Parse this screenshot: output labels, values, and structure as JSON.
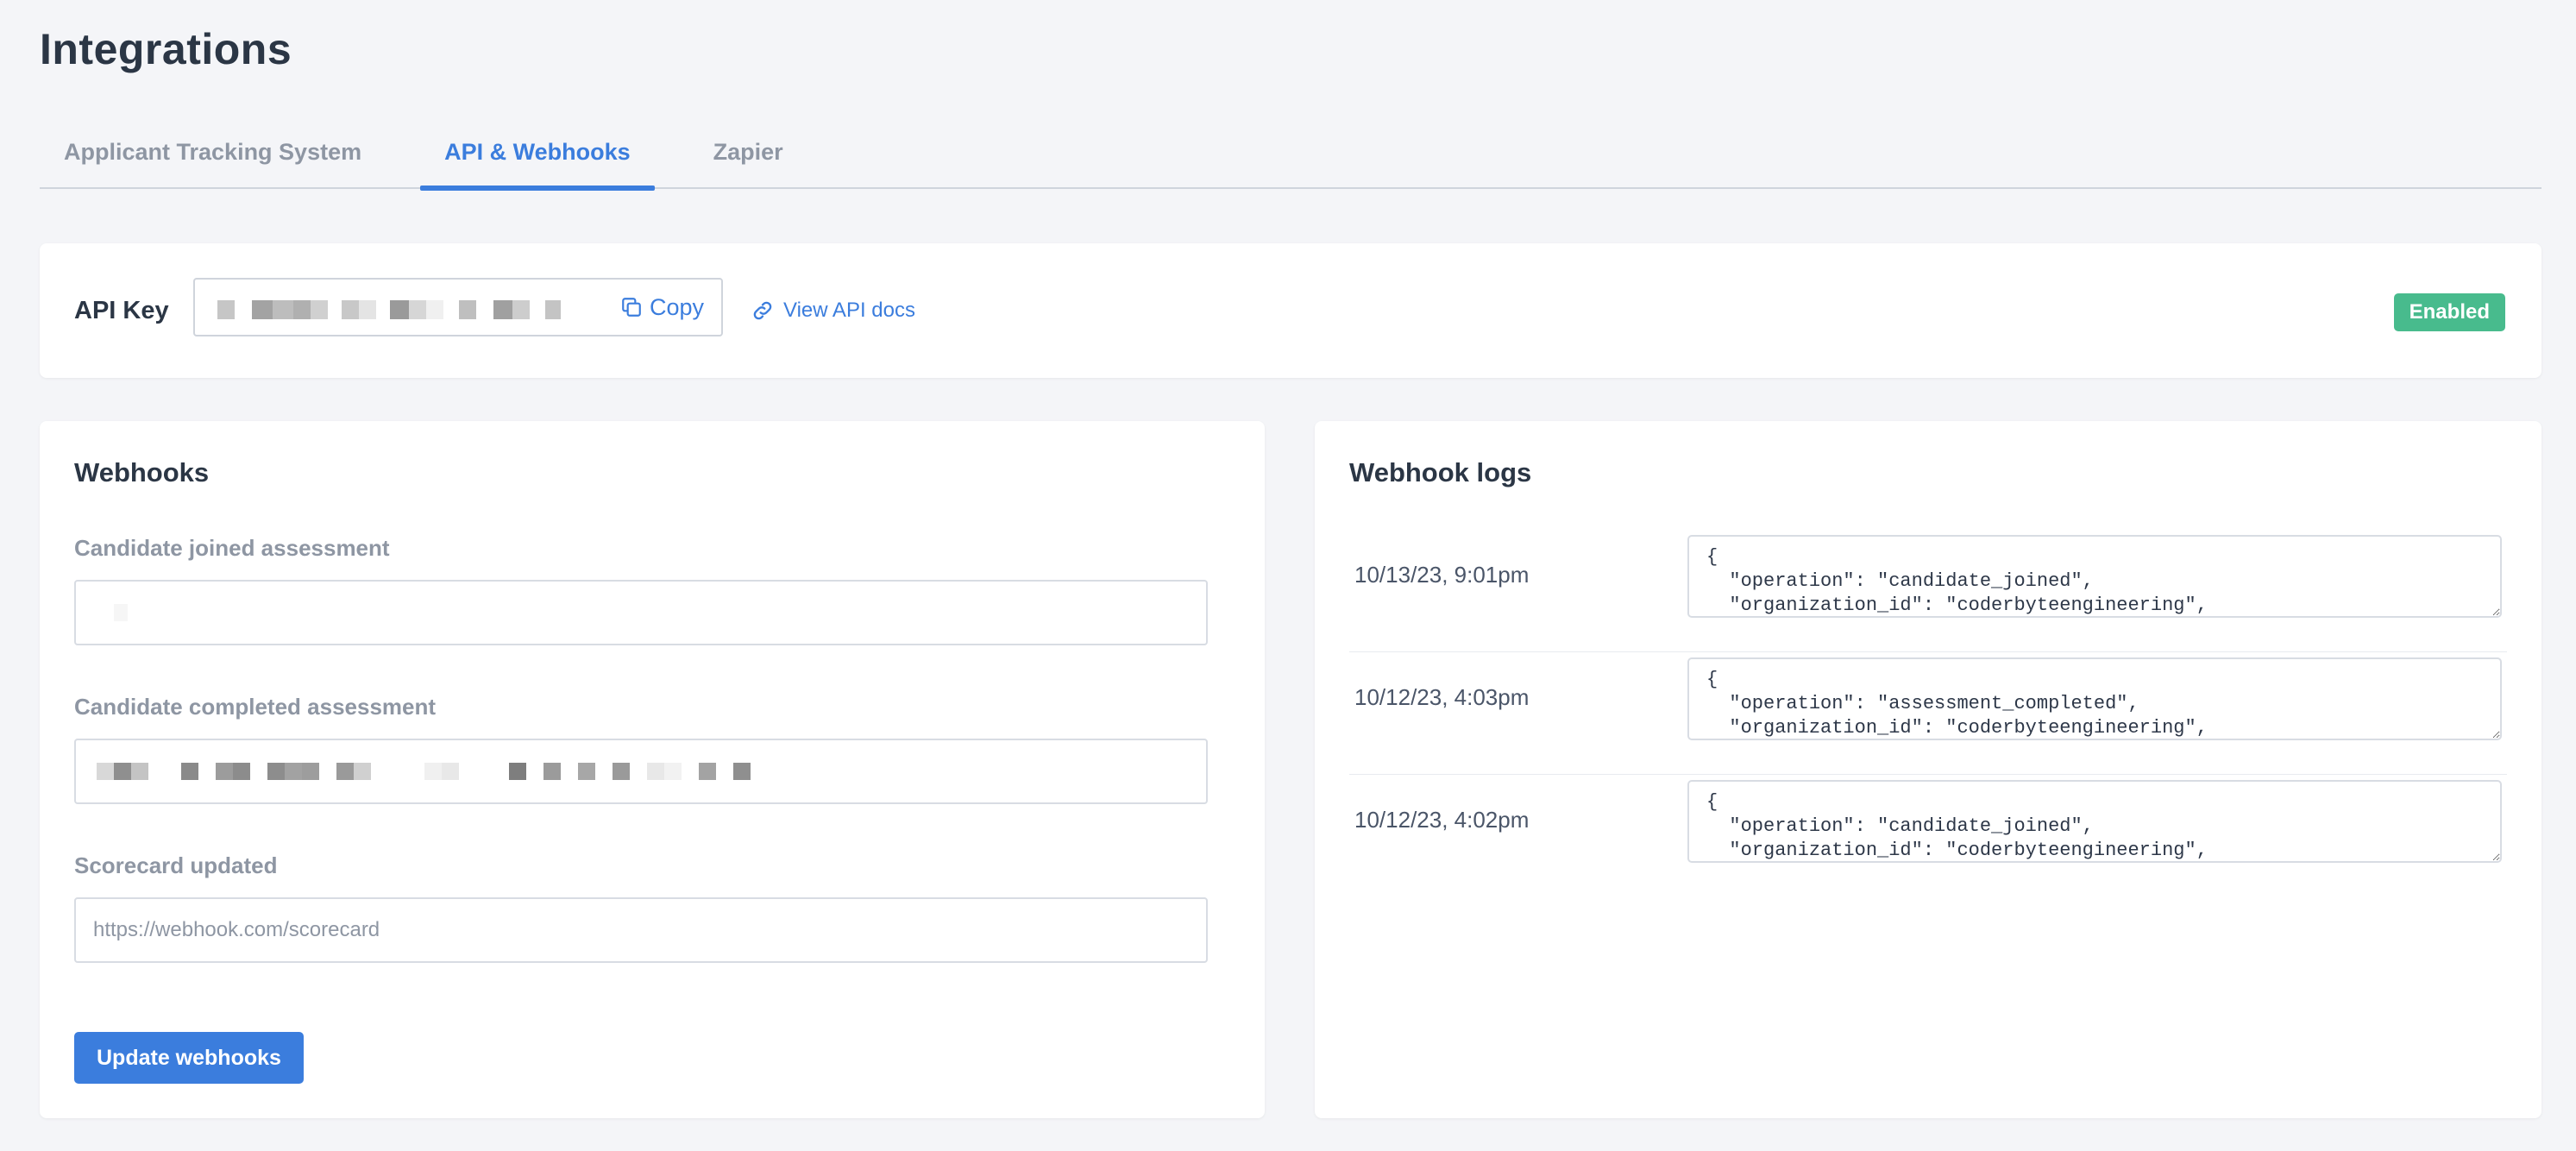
{
  "page": {
    "title": "Integrations"
  },
  "tabs": [
    {
      "label": "Applicant Tracking System",
      "active": false
    },
    {
      "label": "API & Webhooks",
      "active": true
    },
    {
      "label": "Zapier",
      "active": false
    }
  ],
  "api": {
    "label": "API Key",
    "copy_label": "Copy",
    "docs_label": "View API docs",
    "status": "Enabled"
  },
  "webhooks": {
    "title": "Webhooks",
    "fields": [
      {
        "label": "Candidate joined assessment",
        "value": "",
        "placeholder": ""
      },
      {
        "label": "Candidate completed assessment",
        "value": "",
        "placeholder": ""
      },
      {
        "label": "Scorecard updated",
        "value": "",
        "placeholder": "https://webhook.com/scorecard"
      }
    ],
    "button_label": "Update webhooks"
  },
  "logs": {
    "title": "Webhook logs",
    "items": [
      {
        "time": "10/13/23, 9:01pm",
        "payload": "{\n  \"operation\": \"candidate_joined\",\n  \"organization_id\": \"coderbyteengineering\","
      },
      {
        "time": "10/12/23, 4:03pm",
        "payload": "{\n  \"operation\": \"assessment_completed\",\n  \"organization_id\": \"coderbyteengineering\","
      },
      {
        "time": "10/12/23, 4:02pm",
        "payload": "{\n  \"operation\": \"candidate_joined\",\n  \"organization_id\": \"coderbyteengineering\","
      }
    ]
  },
  "colors": {
    "accent": "#3b7ddd",
    "success": "#48bb8d",
    "background": "#f4f5f8"
  },
  "icons": {
    "copy": "copy-icon",
    "link": "link-icon"
  }
}
